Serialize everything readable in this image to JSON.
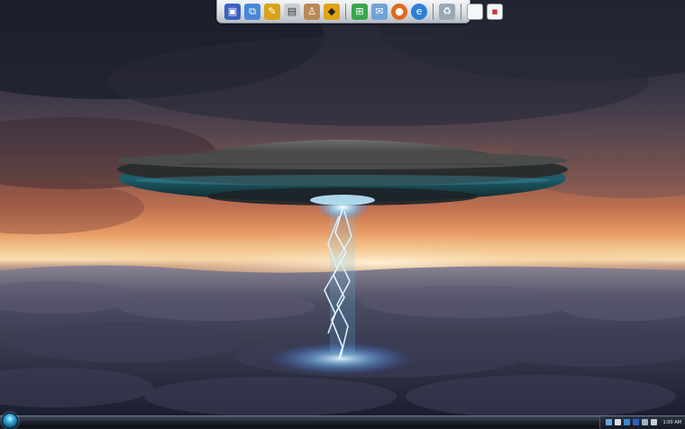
{
  "desktop": {
    "wallpaper": "ufo-above-clouds-wallpaper"
  },
  "quick_launch": {
    "icons": [
      {
        "name": "show-desktop-icon",
        "color": "#3b5fc4"
      },
      {
        "name": "switch-windows-icon",
        "color": "#4a86d8"
      },
      {
        "name": "tools-icon",
        "color": "#d9a21a"
      },
      {
        "name": "notepad-icon",
        "color": "#c8cdd4"
      },
      {
        "name": "figure-icon",
        "color": "#b88a55"
      },
      {
        "name": "warning-sign-icon",
        "color": "#e2a312"
      },
      {
        "name": "windows-flag-icon",
        "color": "#3aa64a"
      },
      {
        "name": "mail-icon",
        "color": "#6fa3d8"
      },
      {
        "name": "firefox-icon",
        "color": "#e06a1c"
      },
      {
        "name": "internet-explorer-icon",
        "color": "#2c7fd6"
      },
      {
        "name": "recycle-bin-icon",
        "color": "#9aa7b6"
      },
      {
        "name": "blank-document-icon",
        "color": "#f4f6f8"
      },
      {
        "name": "window-preview-icon",
        "color": "#c43b3b"
      }
    ]
  },
  "taskbar": {
    "clock": "1:00 AM",
    "tray_icons": [
      "network-icon",
      "security-shield-icon",
      "update-icon",
      "bluetooth-icon",
      "monitor-icon",
      "volume-icon"
    ]
  },
  "colors": {
    "taskbar": "#1f2530",
    "dock": "#d9dde2",
    "beam": "#8fd8ff"
  }
}
